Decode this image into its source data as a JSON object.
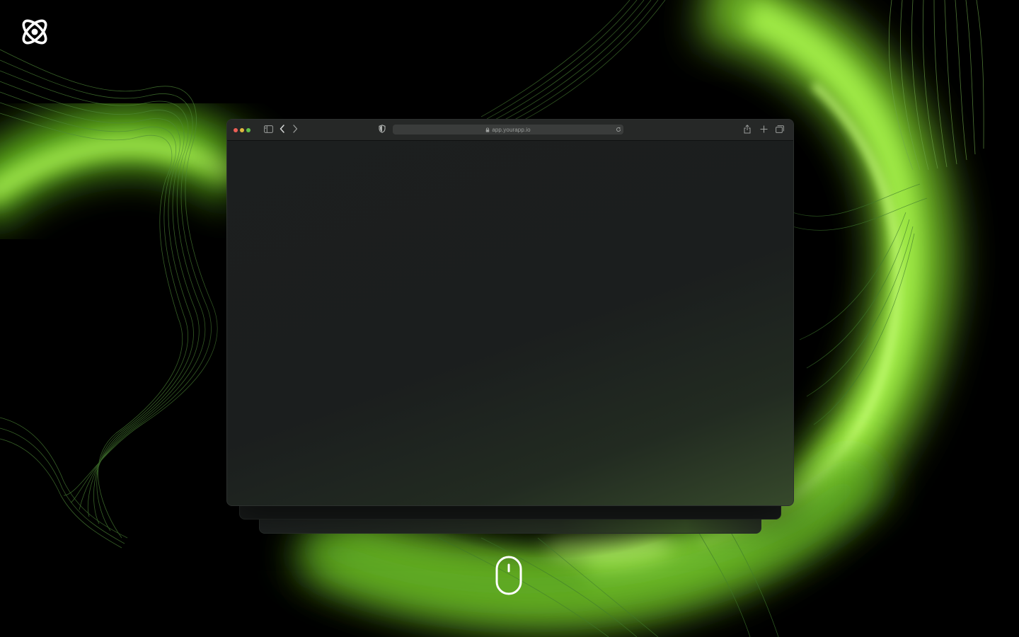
{
  "colors": {
    "accent": "#9efc3c",
    "glow": "#7fd12b",
    "background": "#000000",
    "window": "#1c1f1f",
    "toolbar": "#262827"
  },
  "brand": {
    "logo_icon": "atom-logo-icon"
  },
  "browser": {
    "url": "app.yourapp.io",
    "traffic_lights": [
      "close",
      "minimize",
      "zoom"
    ],
    "toolbar_icons": {
      "sidebar": "sidebar-icon",
      "back": "chevron-left-icon",
      "forward": "chevron-right-icon",
      "privacy": "shield-icon",
      "lock": "lock-icon",
      "reload": "reload-icon",
      "share": "share-icon",
      "new_tab": "plus-icon",
      "tabs": "tabs-overview-icon"
    }
  },
  "scroll_hint": {
    "icon": "mouse-icon"
  }
}
